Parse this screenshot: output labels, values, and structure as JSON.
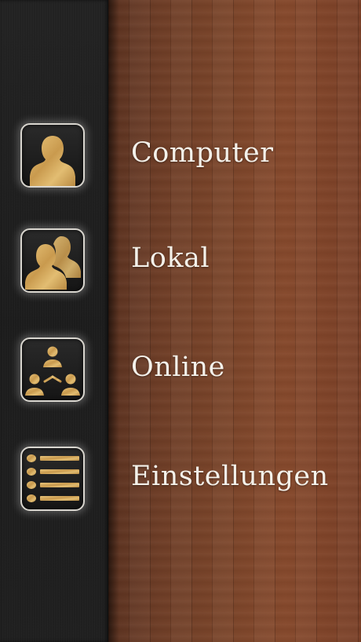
{
  "menu": {
    "items": [
      {
        "label": "Computer",
        "icon": "single-person-icon"
      },
      {
        "label": "Lokal",
        "icon": "two-persons-icon"
      },
      {
        "label": "Online",
        "icon": "network-persons-icon"
      },
      {
        "label": "Einstellungen",
        "icon": "list-icon"
      }
    ]
  },
  "colors": {
    "sidebar": "#1e1e1e",
    "wood": "#7a4429",
    "gold": "#d6ad62",
    "label": "#f4f1ea",
    "icon_border": "#d9d6cf"
  }
}
